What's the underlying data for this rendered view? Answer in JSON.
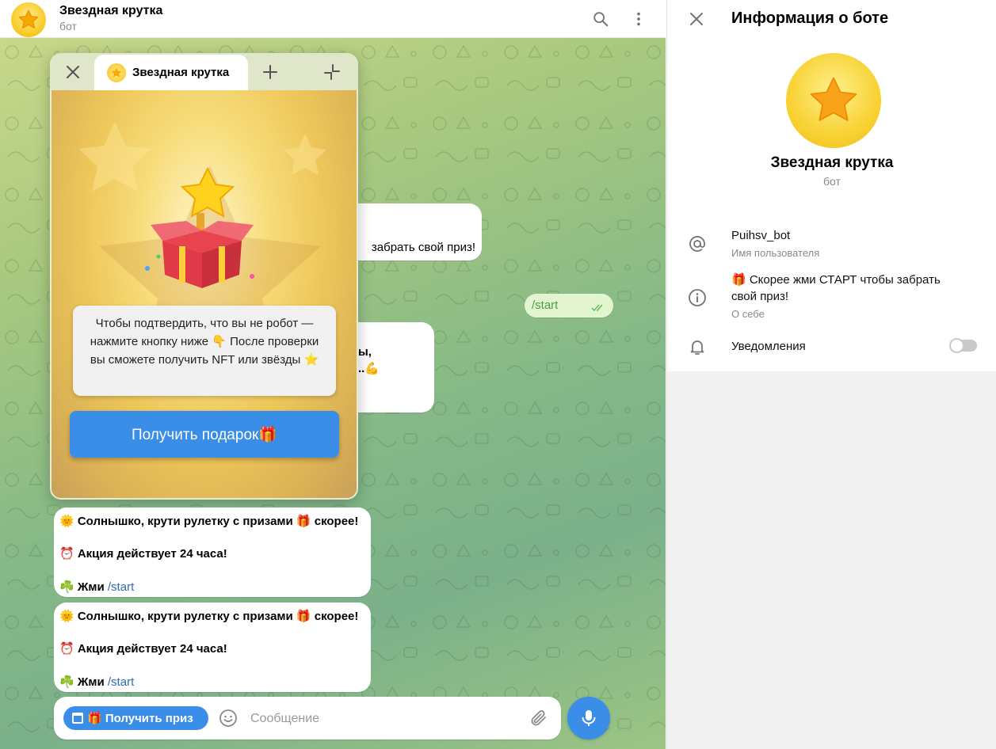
{
  "chat": {
    "title": "Звездная крутка",
    "subtitle": "бот"
  },
  "webapp": {
    "tab_title": "Звездная крутка",
    "verify_text": "Чтобы подтвердить, что вы не робот — нажмите кнопку ниже 👇 После проверки вы сможете получить NFT или звёзды ⭐",
    "gift_button": "Получить подарок🎁"
  },
  "messages": {
    "partial_1": "забрать свой приз!",
    "outgoing_cmd": "/start",
    "partial_2_line1": "ы,",
    "partial_2_line2": "..💪",
    "promo": {
      "line1": "🌞 Солнышко, крути рулетку с призами 🎁 скорее!",
      "line2": "⏰ Акция действует 24 часа!",
      "line3_prefix": "☘️ Жми ",
      "line3_cmd": "/start"
    }
  },
  "composer": {
    "menu_button": "🎁 Получить приз",
    "placeholder": "Сообщение"
  },
  "info_panel": {
    "title": "Информация о боте",
    "bot_name": "Звездная крутка",
    "bot_type": "бот",
    "username": "Puihsv_bot",
    "username_label": "Имя пользователя",
    "about_line1": "🎁 Скорее жми СТАРТ чтобы забрать",
    "about_line2": "свой приз!",
    "about_label": "О себе",
    "notifications_label": "Уведомления",
    "notifications_enabled": false
  },
  "colors": {
    "accent": "#3b8ee8",
    "outgoing_bubble": "#e2f5cf",
    "star": "#f7b500"
  }
}
